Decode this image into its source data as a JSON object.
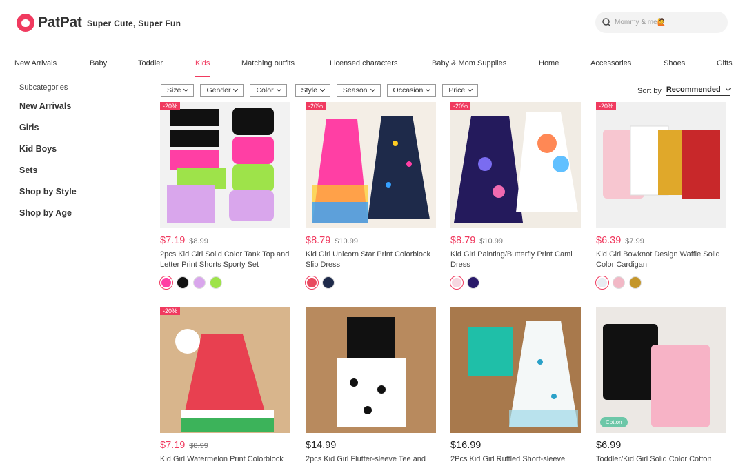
{
  "brand": {
    "name": "PatPat",
    "tagline": "Super Cute, Super Fun",
    "color": "#f03a5f"
  },
  "search": {
    "placeholder": "Mommy & me🙋"
  },
  "nav": [
    {
      "label": "New Arrivals"
    },
    {
      "label": "Baby"
    },
    {
      "label": "Toddler"
    },
    {
      "label": "Kids",
      "active": true
    },
    {
      "label": "Matching outfits"
    },
    {
      "label": "Licensed characters"
    },
    {
      "label": "Baby & Mom Supplies"
    },
    {
      "label": "Home"
    },
    {
      "label": "Accessories"
    },
    {
      "label": "Shoes"
    },
    {
      "label": "Gifts"
    }
  ],
  "sidebar": {
    "title": "Subcategories",
    "items": [
      {
        "label": "New Arrivals"
      },
      {
        "label": "Girls"
      },
      {
        "label": "Kid Boys"
      },
      {
        "label": "Sets"
      },
      {
        "label": "Shop by Style"
      },
      {
        "label": "Shop by Age"
      }
    ]
  },
  "filters": [
    {
      "label": "Size"
    },
    {
      "label": "Gender"
    },
    {
      "label": "Color"
    },
    {
      "label": "Style"
    },
    {
      "label": "Season"
    },
    {
      "label": "Occasion"
    },
    {
      "label": "Price"
    }
  ],
  "sort": {
    "label": "Sort by",
    "value": "Recommended"
  },
  "products": [
    {
      "discount": "-20%",
      "price": "$7.19",
      "old_price": "$8.99",
      "title": "2pcs Kid Girl Solid Color Tank Top and Letter Print Shorts Sporty Set",
      "swatches": [
        "#ff3fa4",
        "#111111",
        "#d9a6ec",
        "#9ee34a"
      ],
      "bg": "#f2f2f2"
    },
    {
      "discount": "-20%",
      "price": "$8.79",
      "old_price": "$10.99",
      "title": "Kid Girl Unicorn Star Print Colorblock Slip Dress",
      "swatches": [
        "#e84a5f",
        "#1e2a4a"
      ],
      "bg": "#f4eee6"
    },
    {
      "discount": "-20%",
      "price": "$8.79",
      "old_price": "$10.99",
      "title": "Kid Girl Painting/Butterfly Print Cami Dress",
      "swatches": [
        "#f7d6e0",
        "#2a1a6a"
      ],
      "bg": "#f1ece4"
    },
    {
      "discount": "-20%",
      "price": "$6.39",
      "old_price": "$7.99",
      "title": "Kid Girl Bowknot Design Waffle Solid Color Cardigan",
      "swatches": [
        "#e8ecf2",
        "#f2b8c6",
        "#c4962a"
      ],
      "bg": "#f0f0f0"
    },
    {
      "discount": "-20%",
      "price": "$7.19",
      "old_price": "$8.99",
      "title": "Kid Girl Watermelon Print Colorblock",
      "swatches": [],
      "bg": "#d8b58c"
    },
    {
      "discount": "",
      "price": "$14.99",
      "old_price": "",
      "title": "2pcs Kid Girl Flutter-sleeve Tee and",
      "swatches": [],
      "bg": "#b88a5e"
    },
    {
      "discount": "",
      "price": "$16.99",
      "old_price": "",
      "title": "2Pcs Kid Girl Ruffled Short-sleeve",
      "swatches": [],
      "bg": "#a8794c"
    },
    {
      "discount": "",
      "price": "$6.99",
      "old_price": "",
      "title": "Toddler/Kid Girl Solid Color Cotton",
      "swatches": [],
      "bg": "#ece8e4",
      "badge": "Cotton"
    }
  ]
}
